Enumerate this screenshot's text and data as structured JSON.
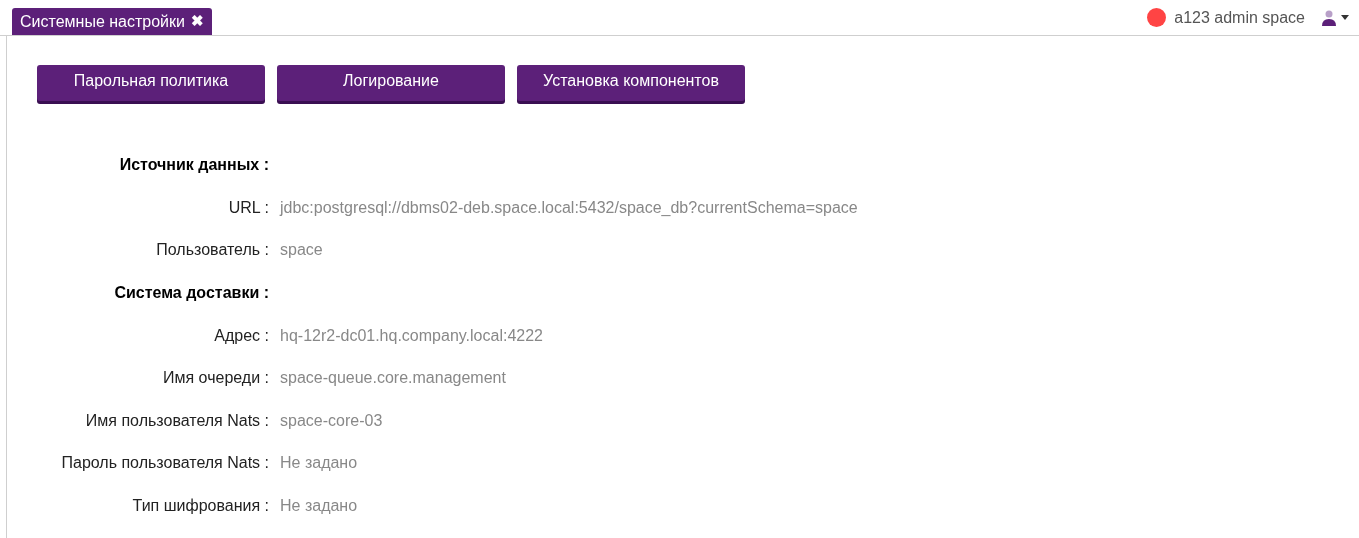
{
  "tab": {
    "label": "Системные настройки",
    "selected": true,
    "close": "✖"
  },
  "user": {
    "status": {
      "color": "#ff4444"
    },
    "name": "a123 admin space"
  },
  "buttons": [
    "Парольная политика",
    "Логирование",
    "Установка компонентов"
  ],
  "rows": [
    {
      "kind": "section",
      "label": "Источник данных :"
    },
    {
      "kind": "field",
      "label": "URL :",
      "value": "jdbc:postgresql://dbms02-deb.space.local:5432/space_db?currentSchema=space"
    },
    {
      "kind": "field",
      "label": "Пользователь :",
      "value": "space"
    },
    {
      "kind": "section",
      "label": "Система доставки :"
    },
    {
      "kind": "field",
      "label": "Адрес :",
      "value": "hq-12r2-dc01.hq.company.local:4222"
    },
    {
      "kind": "field",
      "label": "Имя очереди :",
      "value": "space-queue.core.management"
    },
    {
      "kind": "field",
      "label": "Имя пользователя Nats :",
      "value": "space-core-03"
    },
    {
      "kind": "field",
      "label": "Пароль пользователя Nats :",
      "value": "Не задано"
    },
    {
      "kind": "field",
      "label": "Тип шифрования :",
      "value": "Не задано"
    }
  ]
}
